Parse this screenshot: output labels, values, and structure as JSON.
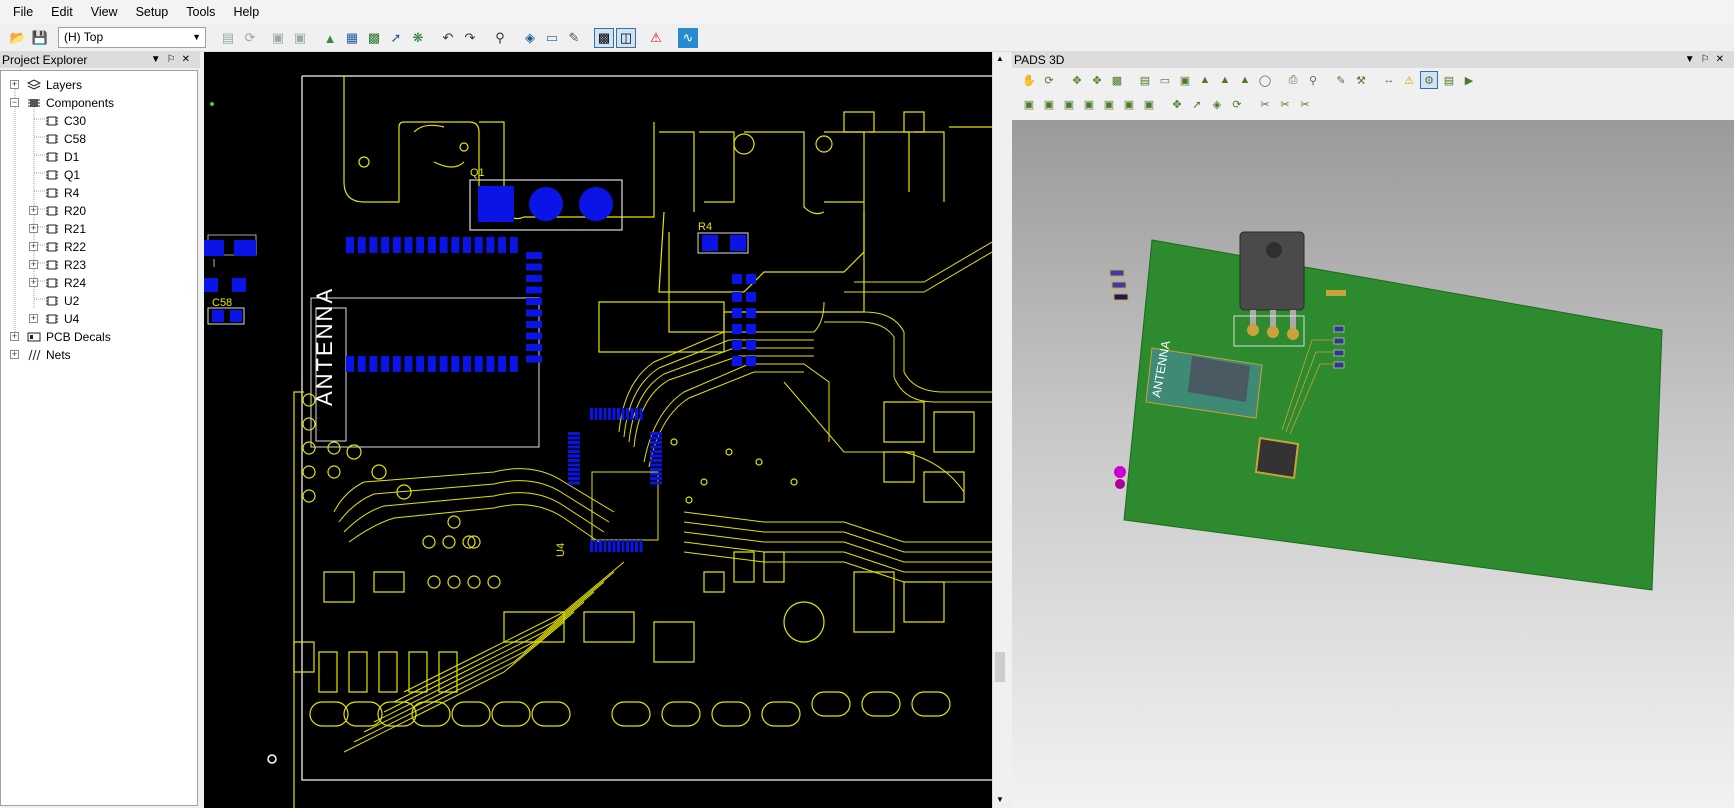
{
  "menu": [
    "File",
    "Edit",
    "View",
    "Setup",
    "Tools",
    "Help"
  ],
  "toolbar": {
    "layer_select": "(H) Top"
  },
  "project_explorer": {
    "title": "Project Explorer",
    "tree": [
      {
        "label": "Layers",
        "expander": "+"
      },
      {
        "label": "Components",
        "expander": "−"
      },
      {
        "label": "C30"
      },
      {
        "label": "C58"
      },
      {
        "label": "D1"
      },
      {
        "label": "Q1"
      },
      {
        "label": "R4"
      },
      {
        "label": "R20",
        "expander": "+"
      },
      {
        "label": "R21",
        "expander": "+"
      },
      {
        "label": "R22",
        "expander": "+"
      },
      {
        "label": "R23",
        "expander": "+"
      },
      {
        "label": "R24",
        "expander": "+"
      },
      {
        "label": "U2"
      },
      {
        "label": "U4",
        "expander": "+"
      },
      {
        "label": "PCB Decals",
        "expander": "+"
      },
      {
        "label": "Nets",
        "expander": "+"
      }
    ]
  },
  "pcb": {
    "antenna_label": "ANTENNA",
    "refdes": {
      "q1": "Q1",
      "r4": "R4",
      "c58": "C58",
      "u4": "U4"
    },
    "colors": {
      "trace": "#e4e400",
      "pad": "#0a14e6",
      "board": "#000000"
    }
  },
  "pads3d": {
    "title": "PADS 3D",
    "antenna_label": "ANTENNA",
    "colors": {
      "board": "#2e8a2e",
      "mark": "#cc00cc"
    }
  }
}
